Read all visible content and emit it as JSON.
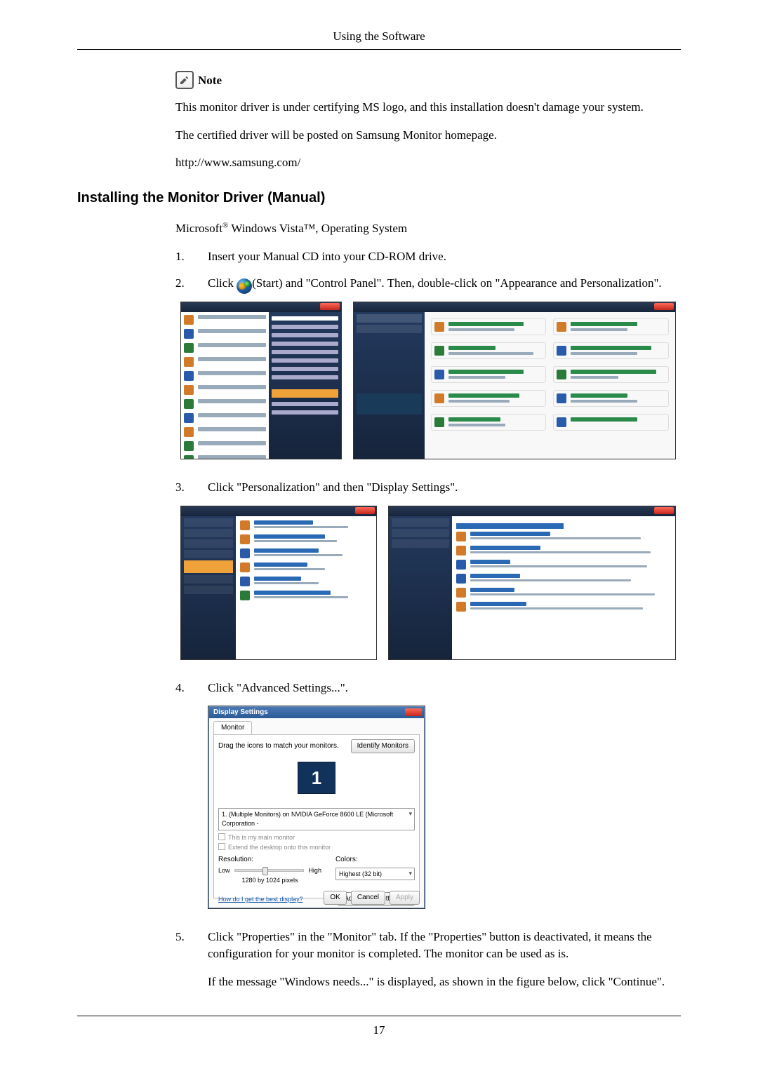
{
  "header": "Using the Software",
  "note_label": "Note",
  "note_p1": "This monitor driver is under certifying MS logo, and this installation doesn't damage your system.",
  "note_p2": "The certified driver will be posted on Samsung Monitor homepage.",
  "note_p3": "http://www.samsung.com/",
  "section_title": "Installing the Monitor Driver (Manual)",
  "os_line_prefix": "Microsoft",
  "os_line_reg": "®",
  "os_line_mid": " Windows Vista™, Operating System",
  "steps": {
    "s1": {
      "num": "1.",
      "text": "Insert your Manual CD into your CD-ROM drive."
    },
    "s2": {
      "num": "2.",
      "pre": "Click ",
      "post": "(Start) and \"Control Panel\". Then, double-click on \"Appearance and Personalization\"."
    },
    "s3": {
      "num": "3.",
      "text": "Click \"Personalization\" and then \"Display Settings\"."
    },
    "s4": {
      "num": "4.",
      "text": "Click \"Advanced Settings...\"."
    },
    "s5": {
      "num": "5.",
      "text": "Click \"Properties\" in the \"Monitor\" tab. If the \"Properties\" button is deactivated, it means the configuration for your monitor is completed. The monitor can be used as is."
    },
    "s5b": "If the message \"Windows needs...\" is displayed, as shown in the figure below, click \"Continue\"."
  },
  "dlg": {
    "title": "Display Settings",
    "tab": "Monitor",
    "drag_text": "Drag the icons to match your monitors.",
    "identify": "Identify Monitors",
    "monitor_num": "1",
    "dropdown": "1. (Multiple Monitors) on NVIDIA GeForce 8600 LE (Microsoft Corporation - ",
    "chk1": "This is my main monitor",
    "chk2": "Extend the desktop onto this monitor",
    "resolution_lbl": "Resolution:",
    "low": "Low",
    "high": "High",
    "res_value": "1280 by 1024 pixels",
    "colors_lbl": "Colors:",
    "colors_val": "Highest (32 bit)",
    "help_link": "How do I get the best display?",
    "adv": "Advanced Settings...",
    "ok": "OK",
    "cancel": "Cancel",
    "apply": "Apply"
  },
  "page_number": "17"
}
